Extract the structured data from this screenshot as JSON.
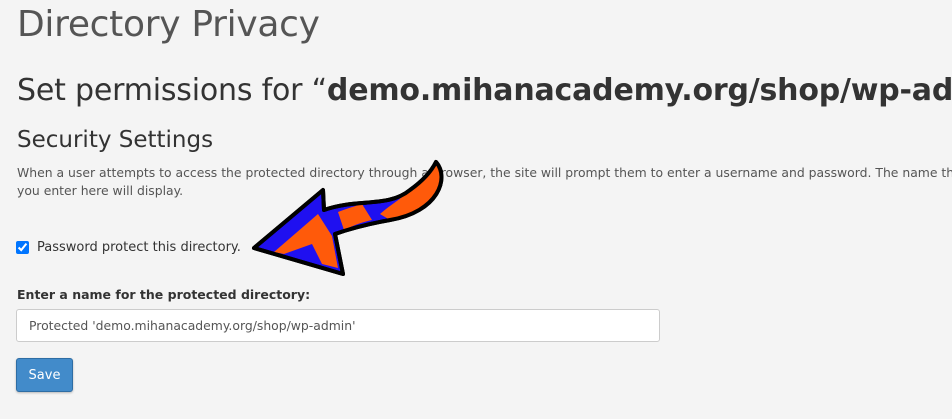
{
  "header": {
    "page_title": "Directory Privacy",
    "permissions_prefix": "Set permissions for “",
    "permissions_path": "demo.mihanacademy.org/shop/wp-admin",
    "permissions_suffix": "”."
  },
  "security_settings": {
    "heading": "Security Settings",
    "description": "When a user attempts to access the protected directory through a browser, the site will prompt them to enter a username and password. The name that you enter here will display.",
    "password_protect": {
      "label": "Password protect this directory.",
      "checked": true
    },
    "directory_name": {
      "label": "Enter a name for the protected directory:",
      "value": "Protected 'demo.mihanacademy.org/shop/wp-admin'"
    },
    "save_label": "Save"
  },
  "annotation": {
    "arrow_icon": "pointing-arrow-icon",
    "colors": {
      "blue": "#1f10f0",
      "orange": "#ff5a0a",
      "outline": "#000000"
    }
  },
  "colors": {
    "background": "#f4f4f4",
    "button": "#428bca",
    "button_border": "#2e6da4",
    "title_text": "#555555",
    "body_text": "#333333"
  }
}
